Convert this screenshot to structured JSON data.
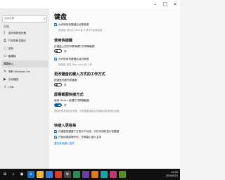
{
  "window": {
    "minimize_icon": "minimize-icon",
    "maximize_icon": "maximize-icon",
    "close_icon": "close-icon"
  },
  "sidebar": {
    "search_placeholder": "查找设置",
    "section": "设备",
    "items": [
      {
        "icon": "bluetooth-icon",
        "label": "蓝牙和其他设备"
      },
      {
        "icon": "printer-icon",
        "label": "打印机和扫描仪"
      },
      {
        "icon": "mouse-icon",
        "label": "鼠标"
      },
      {
        "icon": "touchpad-icon",
        "label": "触摸板"
      },
      {
        "icon": "keyboard-icon",
        "label": "输入"
      },
      {
        "icon": "pen-icon",
        "label": "笔和 Windows Ink"
      },
      {
        "icon": "autoplay-icon",
        "label": "自动播放"
      },
      {
        "icon": "usb-icon",
        "label": "USB"
      }
    ]
  },
  "content": {
    "title": "键盘",
    "filter_check": "允许使用快捷键启动筛选键",
    "filter_sub": "快捷键: 按住右 Shift 键 8 秒可开启筛选键",
    "hotkey_heading": "使用快捷键",
    "hotkey_label": "在键盘上的打印屏幕键打开屏幕截图",
    "hotkey_toggle": "关",
    "hotkey_check": "允许使用快捷键启动切换键",
    "hotkey_sub": "快捷键: 按住 Num Lock 键 5 秒",
    "typing_heading": "更改键盘的键入方式的工作方式",
    "typing_label": "按键盘的额外快捷键",
    "typing_toggle": "关",
    "screen_heading": "屏幕截图快捷方式",
    "screen_label": "使用 PrtScn 按键打开屏幕截图",
    "screen_toggle": "开",
    "screen_sub": "根据你的其他应用设置，可能需要重新启动电脑才能更改此设置。",
    "easier_heading": "快捷入更容易",
    "easier_check1": "在键盘快捷键下方显示下划线，可在可用时显示快捷键",
    "easier_check2": "在使用键盘操作时，在屏幕上输入文本",
    "easier_link": "更改其他键入选项"
  },
  "taskbar": {
    "apps": [
      "windows-icon",
      "search-icon",
      "task-view-icon",
      "edge-icon",
      "folder-icon",
      "store-icon",
      "mail-icon",
      "settings-icon",
      "photos-icon",
      "video-icon",
      "app-icon",
      "app2-icon",
      "app3-icon",
      "app4-icon"
    ],
    "time": "12:00",
    "date": "2020/8/20"
  }
}
